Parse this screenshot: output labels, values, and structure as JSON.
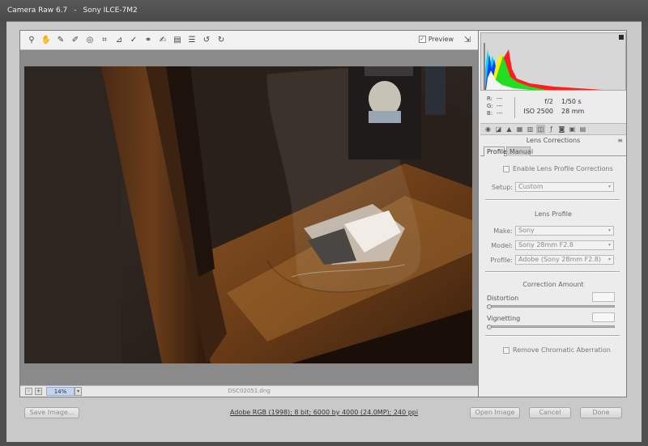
{
  "titlebar": {
    "app": "Camera Raw 6.7",
    "separator": "-",
    "camera": "Sony ILCE-7M2"
  },
  "toolbar": {
    "tools": [
      "zoom-tool-icon",
      "hand-tool-icon",
      "white-balance-tool-icon",
      "color-sampler-tool-icon",
      "targeted-adjustment-tool-icon",
      "crop-tool-icon",
      "straighten-tool-icon",
      "spot-removal-tool-icon",
      "red-eye-removal-tool-icon",
      "adjustment-brush-icon",
      "graduated-filter-icon",
      "preferences-icon",
      "rotate-left-icon",
      "rotate-right-icon"
    ],
    "preview_label": "Preview",
    "preview_checked": true
  },
  "status": {
    "zoom_minus": "-",
    "zoom_plus": "+",
    "zoom": "14%",
    "filename": "DSC02051.dng"
  },
  "histogram": {
    "colors": [
      "#0000ff",
      "#00ffff",
      "#00ff00",
      "#ffff00",
      "#ff0000",
      "#ffffff"
    ]
  },
  "readout": {
    "r_label": "R:",
    "r_value": "---",
    "g_label": "G:",
    "g_value": "---",
    "b_label": "B:",
    "b_value": "---",
    "aperture": "f/2",
    "shutter": "1/50 s",
    "iso": "ISO 2500",
    "focal": "28 mm"
  },
  "panel": {
    "title": "Lens Corrections",
    "menu_icon": "≡",
    "tabs": {
      "profile": "Profile",
      "manual": "Manual"
    },
    "enable_label": "Enable Lens Profile Corrections",
    "setup_label": "Setup:",
    "setup_value": "Custom",
    "lens_profile_header": "Lens Profile",
    "make_label": "Make:",
    "make_value": "Sony",
    "model_label": "Model:",
    "model_value": "Sony 28mm F2.8",
    "profile_label": "Profile:",
    "profile_value": "Adobe (Sony 28mm F2.8)",
    "correction_header": "Correction Amount",
    "distortion_label": "Distortion",
    "vignetting_label": "Vignetting",
    "chromatic_label": "Remove Chromatic Aberration"
  },
  "bottom": {
    "save": "Save Image...",
    "workflow": "Adobe RGB (1998); 8 bit; 6000 by 4000 (24.0MP); 240 ppi",
    "open": "Open Image",
    "cancel": "Cancel",
    "done": "Done"
  }
}
